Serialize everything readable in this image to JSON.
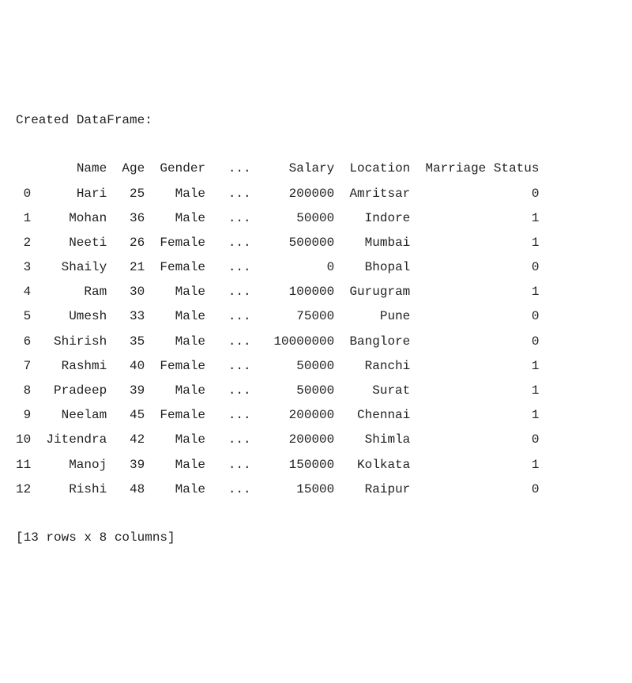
{
  "title": "Created DataFrame:",
  "columns": {
    "idx": "",
    "name": "Name",
    "age": "Age",
    "gender": "Gender",
    "ell": "...",
    "salary": "Salary",
    "location": "Location",
    "marriage": "Marriage",
    "status": "Status"
  },
  "rows": [
    {
      "idx": "0",
      "name": "Hari",
      "age": "25",
      "gender": "Male",
      "ell": "...",
      "salary": "200000",
      "location": "Amritsar",
      "marriage": "",
      "status": "0"
    },
    {
      "idx": "1",
      "name": "Mohan",
      "age": "36",
      "gender": "Male",
      "ell": "...",
      "salary": "50000",
      "location": "Indore",
      "marriage": "",
      "status": "1"
    },
    {
      "idx": "2",
      "name": "Neeti",
      "age": "26",
      "gender": "Female",
      "ell": "...",
      "salary": "500000",
      "location": "Mumbai",
      "marriage": "",
      "status": "1"
    },
    {
      "idx": "3",
      "name": "Shaily",
      "age": "21",
      "gender": "Female",
      "ell": "...",
      "salary": "0",
      "location": "Bhopal",
      "marriage": "",
      "status": "0"
    },
    {
      "idx": "4",
      "name": "Ram",
      "age": "30",
      "gender": "Male",
      "ell": "...",
      "salary": "100000",
      "location": "Gurugram",
      "marriage": "",
      "status": "1"
    },
    {
      "idx": "5",
      "name": "Umesh",
      "age": "33",
      "gender": "Male",
      "ell": "...",
      "salary": "75000",
      "location": "Pune",
      "marriage": "",
      "status": "0"
    },
    {
      "idx": "6",
      "name": "Shirish",
      "age": "35",
      "gender": "Male",
      "ell": "...",
      "salary": "10000000",
      "location": "Banglore",
      "marriage": "",
      "status": "0"
    },
    {
      "idx": "7",
      "name": "Rashmi",
      "age": "40",
      "gender": "Female",
      "ell": "...",
      "salary": "50000",
      "location": "Ranchi",
      "marriage": "",
      "status": "1"
    },
    {
      "idx": "8",
      "name": "Pradeep",
      "age": "39",
      "gender": "Male",
      "ell": "...",
      "salary": "50000",
      "location": "Surat",
      "marriage": "",
      "status": "1"
    },
    {
      "idx": "9",
      "name": "Neelam",
      "age": "45",
      "gender": "Female",
      "ell": "...",
      "salary": "200000",
      "location": "Chennai",
      "marriage": "",
      "status": "1"
    },
    {
      "idx": "10",
      "name": "Jitendra",
      "age": "42",
      "gender": "Male",
      "ell": "...",
      "salary": "200000",
      "location": "Shimla",
      "marriage": "",
      "status": "0"
    },
    {
      "idx": "11",
      "name": "Manoj",
      "age": "39",
      "gender": "Male",
      "ell": "...",
      "salary": "150000",
      "location": "Kolkata",
      "marriage": "",
      "status": "1"
    },
    {
      "idx": "12",
      "name": "Rishi",
      "age": "48",
      "gender": "Male",
      "ell": "...",
      "salary": "15000",
      "location": "Raipur",
      "marriage": "",
      "status": "0"
    }
  ],
  "footer": "[13 rows x 8 columns]"
}
